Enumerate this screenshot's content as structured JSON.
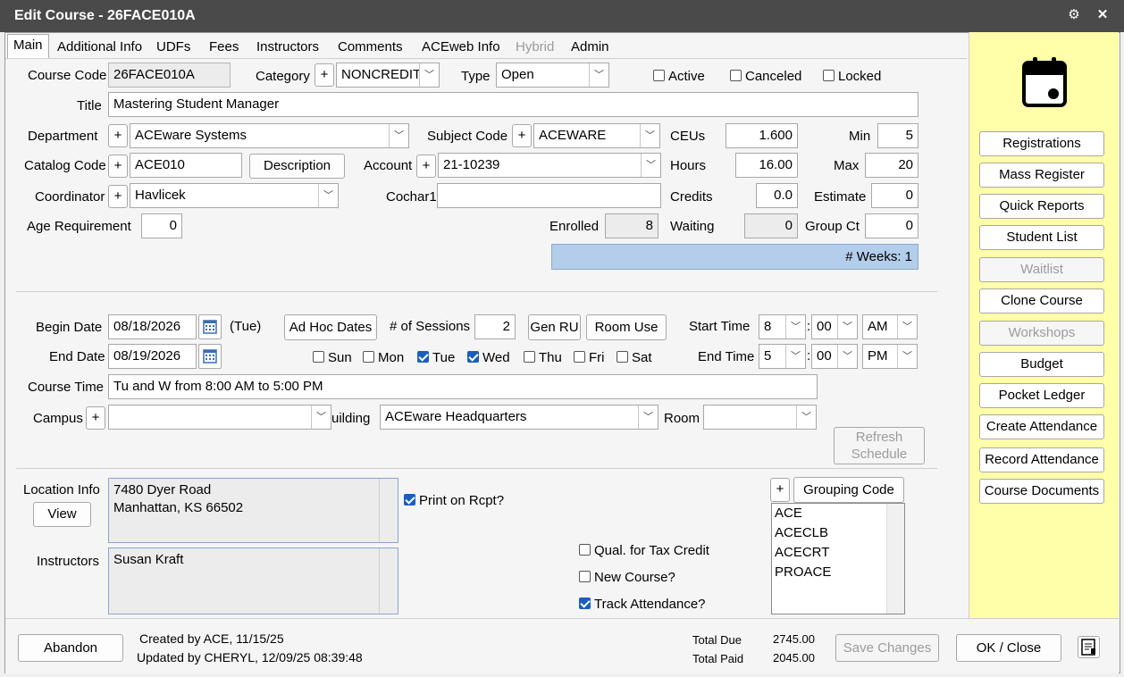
{
  "window": {
    "title": "Edit Course - 26FACE010A"
  },
  "tabs": [
    {
      "label": "Main",
      "active": true
    },
    {
      "label": "Additional Info"
    },
    {
      "label": "UDFs"
    },
    {
      "label": "Fees"
    },
    {
      "label": "Instructors"
    },
    {
      "label": "Comments"
    },
    {
      "label": "ACEweb Info"
    },
    {
      "label": "Hybrid",
      "disabled": true
    },
    {
      "label": "Admin"
    }
  ],
  "course": {
    "code_label": "Course Code",
    "code": "26FACE010A",
    "category_label": "Category",
    "category": "NONCREDIT",
    "type_label": "Type",
    "type": "Open",
    "active_label": "Active",
    "canceled_label": "Canceled",
    "locked_label": "Locked",
    "title_label": "Title",
    "title": "Mastering Student Manager",
    "department_label": "Department",
    "department": "ACEware Systems",
    "subject_code_label": "Subject Code",
    "subject_code": "ACEWARE",
    "ceus_label": "CEUs",
    "ceus": "1.600",
    "min_label": "Min",
    "min": "5",
    "catalog_code_label": "Catalog Code",
    "catalog_code": "ACE010",
    "description_button": "Description",
    "account_label": "Account",
    "account": "21-10239",
    "hours_label": "Hours",
    "hours": "16.00",
    "max_label": "Max",
    "max": "20",
    "coordinator_label": "Coordinator",
    "coordinator": "Havlicek",
    "cochar1_label": "Cochar1",
    "cochar1": "",
    "credits_label": "Credits",
    "credits": "0.0",
    "estimate_label": "Estimate",
    "estimate": "0",
    "age_req_label": "Age Requirement",
    "age_req": "0",
    "enrolled_label": "Enrolled",
    "enrolled": "8",
    "waiting_label": "Waiting",
    "waiting": "0",
    "group_ct_label": "Group Ct",
    "group_ct": "0",
    "weeks": "# Weeks: 1"
  },
  "schedule": {
    "begin_date_label": "Begin Date",
    "begin_date": "08/18/2026",
    "begin_day": "(Tue)",
    "end_date_label": "End Date",
    "end_date": "08/19/2026",
    "adhoc_button": "Ad Hoc Dates",
    "sessions_label": "# of Sessions",
    "sessions": "2",
    "gen_ru_button": "Gen RU",
    "room_use_button": "Room Use",
    "start_time_label": "Start Time",
    "start_hour": "8",
    "start_min": "00",
    "start_ampm": "AM",
    "end_time_label": "End Time",
    "end_hour": "5",
    "end_min": "00",
    "end_ampm": "PM",
    "time_sep": ":",
    "days": {
      "sun": "Sun",
      "mon": "Mon",
      "tue": "Tue",
      "wed": "Wed",
      "thu": "Thu",
      "fri": "Fri",
      "sat": "Sat"
    },
    "course_time_label": "Course Time",
    "course_time": "Tu and W from 8:00 AM to 5:00 PM",
    "campus_label": "Campus",
    "campus": "",
    "building_label": "uilding",
    "building": "ACEware Headquarters",
    "room_label": "Room",
    "room": "",
    "refresh_button_line1": "Refresh",
    "refresh_button_line2": "Schedule"
  },
  "location": {
    "label": "Location Info",
    "view_button": "View",
    "line1": "7480 Dyer Road",
    "line2": "Manhattan, KS  66502",
    "print_label": "Print on Rcpt?",
    "instructors_label": "Instructors",
    "instructors": "Susan Kraft",
    "qual_tax_label": "Qual. for Tax Credit",
    "new_course_label": "New Course?",
    "track_attendance_label": "Track Attendance?",
    "grouping_button": "Grouping Code",
    "grouping_codes": [
      "ACE",
      "ACECLB",
      "ACECRT",
      "PROACE"
    ]
  },
  "sidebar": {
    "buttons": [
      {
        "label": "Registrations"
      },
      {
        "label": "Mass Register"
      },
      {
        "label": "Quick Reports"
      },
      {
        "label": "Student List"
      },
      {
        "label": "Waitlist",
        "disabled": true
      },
      {
        "label": "Clone Course"
      },
      {
        "label": "Workshops",
        "disabled": true
      },
      {
        "label": "Budget"
      },
      {
        "label": "Pocket Ledger"
      },
      {
        "label": "Create Attendance"
      },
      {
        "label": "Record Attendance"
      },
      {
        "label": "Course Documents"
      }
    ]
  },
  "footer": {
    "abandon_button": "Abandon",
    "created": "Created by ACE, 11/15/25",
    "updated": "Updated by CHERYL, 12/09/25 08:39:48",
    "total_due_label": "Total Due",
    "total_due": "2745.00",
    "total_paid_label": "Total Paid",
    "total_paid": "2045.00",
    "save_button": "Save Changes",
    "ok_button": "OK / Close"
  },
  "plus_sign": "+"
}
